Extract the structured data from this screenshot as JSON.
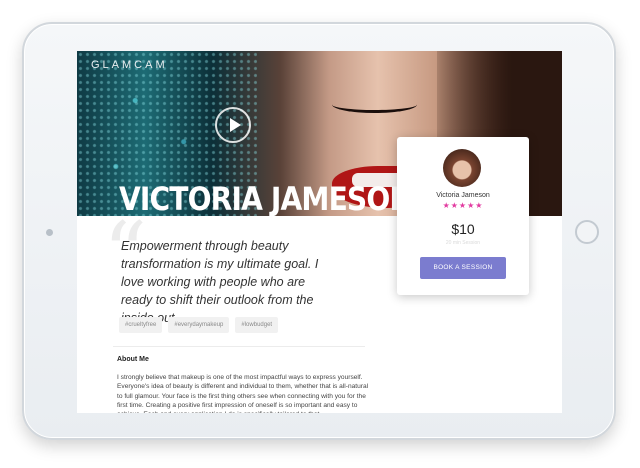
{
  "brand": {
    "logo": "GLAMCAM"
  },
  "profile": {
    "name": "VICTORIA JAMESON",
    "quote": "Empowerment through beauty transformation is my ultimate goal. I love working with people who are ready to shift their outlook from the inside out.",
    "tags": [
      "#crueltyfree",
      "#everydaymakeup",
      "#lowbudget"
    ]
  },
  "about": {
    "title": "About Me",
    "body": "I strongly believe that makeup is one of the most impactful ways to express yourself. Everyone's idea of beauty is different and individual to them, whether that is all-natural to full glamour. Your face is the first thing others see when connecting with you for the first time. Creating a positive first impression of oneself is so important and easy to achieve. Each and every application I do is specifically tailored to that"
  },
  "booking_card": {
    "name": "Victoria Jameson",
    "rating_stars": "★★★★★",
    "rating_value": 5,
    "price": "$10",
    "session_label": "20 min Session",
    "button_label": "BOOK A SESSION"
  },
  "colors": {
    "accent": "#7b7ccf",
    "stars": "#e23aa0",
    "lips": "#b01616"
  },
  "icons": {
    "play": "play-icon",
    "quote": "quote-icon"
  }
}
